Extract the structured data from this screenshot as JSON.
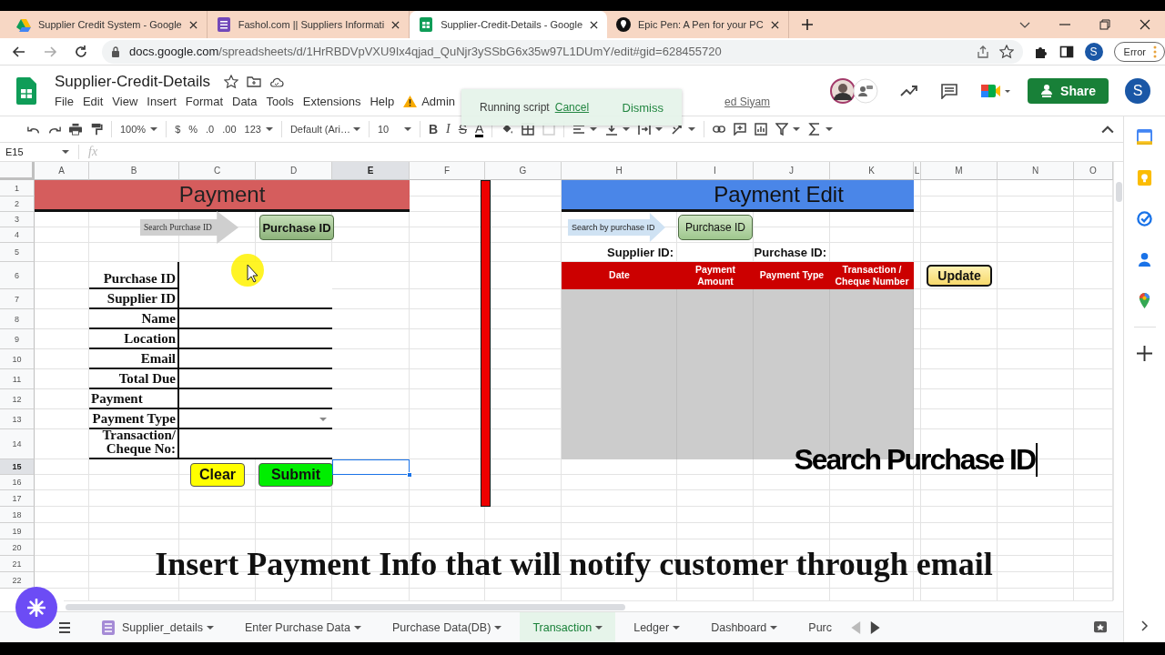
{
  "browser": {
    "tabs": [
      {
        "title": "Supplier Credit System - Google",
        "kind": "drive",
        "selected": false
      },
      {
        "title": "Fashol.com || Suppliers Informati",
        "kind": "forms",
        "selected": false
      },
      {
        "title": "Supplier-Credit-Details - Google",
        "kind": "sheets",
        "selected": true
      },
      {
        "title": "Epic Pen: A Pen for your PC",
        "kind": "pen",
        "selected": false
      }
    ],
    "url": {
      "domain": "docs.google.com",
      "path": "/spreadsheets/d/1HrRBDVpVXU9Ix4qjad_QuNjr3ySSbG6x35w97L1DUmY/edit#gid=628455720"
    },
    "profile_initial": "S",
    "error_label": "Error"
  },
  "doc": {
    "title": "Supplier-Credit-Details",
    "menu": [
      "File",
      "Edit",
      "View",
      "Insert",
      "Format",
      "Data",
      "Tools",
      "Extensions",
      "Help"
    ],
    "admin_menu": "Admin",
    "last_edit_link": "ed Siyam",
    "share_button": "Share",
    "account_initial": "S"
  },
  "toast": {
    "message": "Running script",
    "cancel": "Cancel",
    "dismiss": "Dismiss"
  },
  "toolbar": {
    "zoom": "100%",
    "currency": "$",
    "percent": "%",
    "decrease_decimal": ".0",
    "increase_decimal": ".00",
    "number_format": "123",
    "font": "Default (Ari…",
    "font_size": "10",
    "bold": "B",
    "italic": "I",
    "strikethrough": "S",
    "text_color": "A"
  },
  "formula_bar": {
    "name_box": "E15",
    "fx": "fx"
  },
  "columns": [
    {
      "label": "A",
      "selected": false
    },
    {
      "label": "B",
      "selected": false
    },
    {
      "label": "C",
      "selected": false
    },
    {
      "label": "D",
      "selected": false
    },
    {
      "label": "E",
      "selected": true
    },
    {
      "label": "F",
      "selected": false
    },
    {
      "label": "G",
      "selected": false
    },
    {
      "label": "H",
      "selected": false
    },
    {
      "label": "I",
      "selected": false
    },
    {
      "label": "J",
      "selected": false
    },
    {
      "label": "K",
      "selected": false
    },
    {
      "label": "L",
      "selected": false
    },
    {
      "label": "M",
      "selected": false
    },
    {
      "label": "N",
      "selected": false
    },
    {
      "label": "O",
      "selected": false
    }
  ],
  "rows": [
    {
      "label": "1",
      "selected": false
    },
    {
      "label": "2",
      "selected": false
    },
    {
      "label": "3",
      "selected": false
    },
    {
      "label": "4",
      "selected": false
    },
    {
      "label": "5",
      "selected": false
    },
    {
      "label": "6",
      "selected": false
    },
    {
      "label": "7",
      "selected": false
    },
    {
      "label": "8",
      "selected": false
    },
    {
      "label": "9",
      "selected": false
    },
    {
      "label": "10",
      "selected": false
    },
    {
      "label": "11",
      "selected": false
    },
    {
      "label": "12",
      "selected": false
    },
    {
      "label": "13",
      "selected": false
    },
    {
      "label": "14",
      "selected": false
    },
    {
      "label": "15",
      "selected": true
    },
    {
      "label": "16",
      "selected": false
    },
    {
      "label": "17",
      "selected": false
    },
    {
      "label": "18",
      "selected": false
    },
    {
      "label": "19",
      "selected": false
    },
    {
      "label": "20",
      "selected": false
    },
    {
      "label": "21",
      "selected": false
    },
    {
      "label": "22",
      "selected": false
    }
  ],
  "payment_form": {
    "title": "Payment",
    "search_arrow": "Search Purchase ID",
    "purchase_id_button": "Purchase ID",
    "fields": [
      {
        "label": "Purchase ID",
        "left_aligned": false,
        "kind": "text"
      },
      {
        "label": "Supplier ID",
        "left_aligned": false,
        "kind": "text"
      },
      {
        "label": "Name",
        "left_aligned": false,
        "kind": "text"
      },
      {
        "label": "Location",
        "left_aligned": false,
        "kind": "text"
      },
      {
        "label": "Email",
        "left_aligned": false,
        "kind": "text"
      },
      {
        "label": "Total Due",
        "left_aligned": false,
        "kind": "text"
      },
      {
        "label": "Payment",
        "left_aligned": true,
        "kind": "text"
      },
      {
        "label": "Payment Type",
        "left_aligned": false,
        "kind": "dropdown"
      },
      {
        "label": "Transaction/\nCheque No:",
        "left_aligned": false,
        "kind": "text"
      }
    ],
    "clear_button": "Clear",
    "submit_button": "Submit"
  },
  "payment_edit": {
    "title": "Payment Edit",
    "search_arrow": "Search by purchase ID",
    "purchase_id_button": "Purchase ID",
    "supplier_id_label": "Supplier ID:",
    "purchase_id_label": "Purchase ID:",
    "table_columns": [
      "Date",
      "Payment Amount",
      "Payment Type",
      "Transaction / Cheque Number"
    ],
    "update_button": "Update"
  },
  "video_overlay": {
    "heading": "Search Purchase ID",
    "caption": "Insert Payment Info that will notify customer through email"
  },
  "sheet_tabs": [
    {
      "label": "Supplier_details",
      "kind": "form",
      "selected": false
    },
    {
      "label": "Enter Purchase Data",
      "kind": "sheet",
      "selected": false
    },
    {
      "label": "Purchase Data(DB)",
      "kind": "sheet",
      "selected": false
    },
    {
      "label": "Transaction",
      "kind": "sheet",
      "selected": true
    },
    {
      "label": "Ledger",
      "kind": "sheet",
      "selected": false
    },
    {
      "label": "Dashboard",
      "kind": "sheet",
      "selected": false
    },
    {
      "label": "Purc",
      "kind": "cut",
      "selected": false
    }
  ]
}
